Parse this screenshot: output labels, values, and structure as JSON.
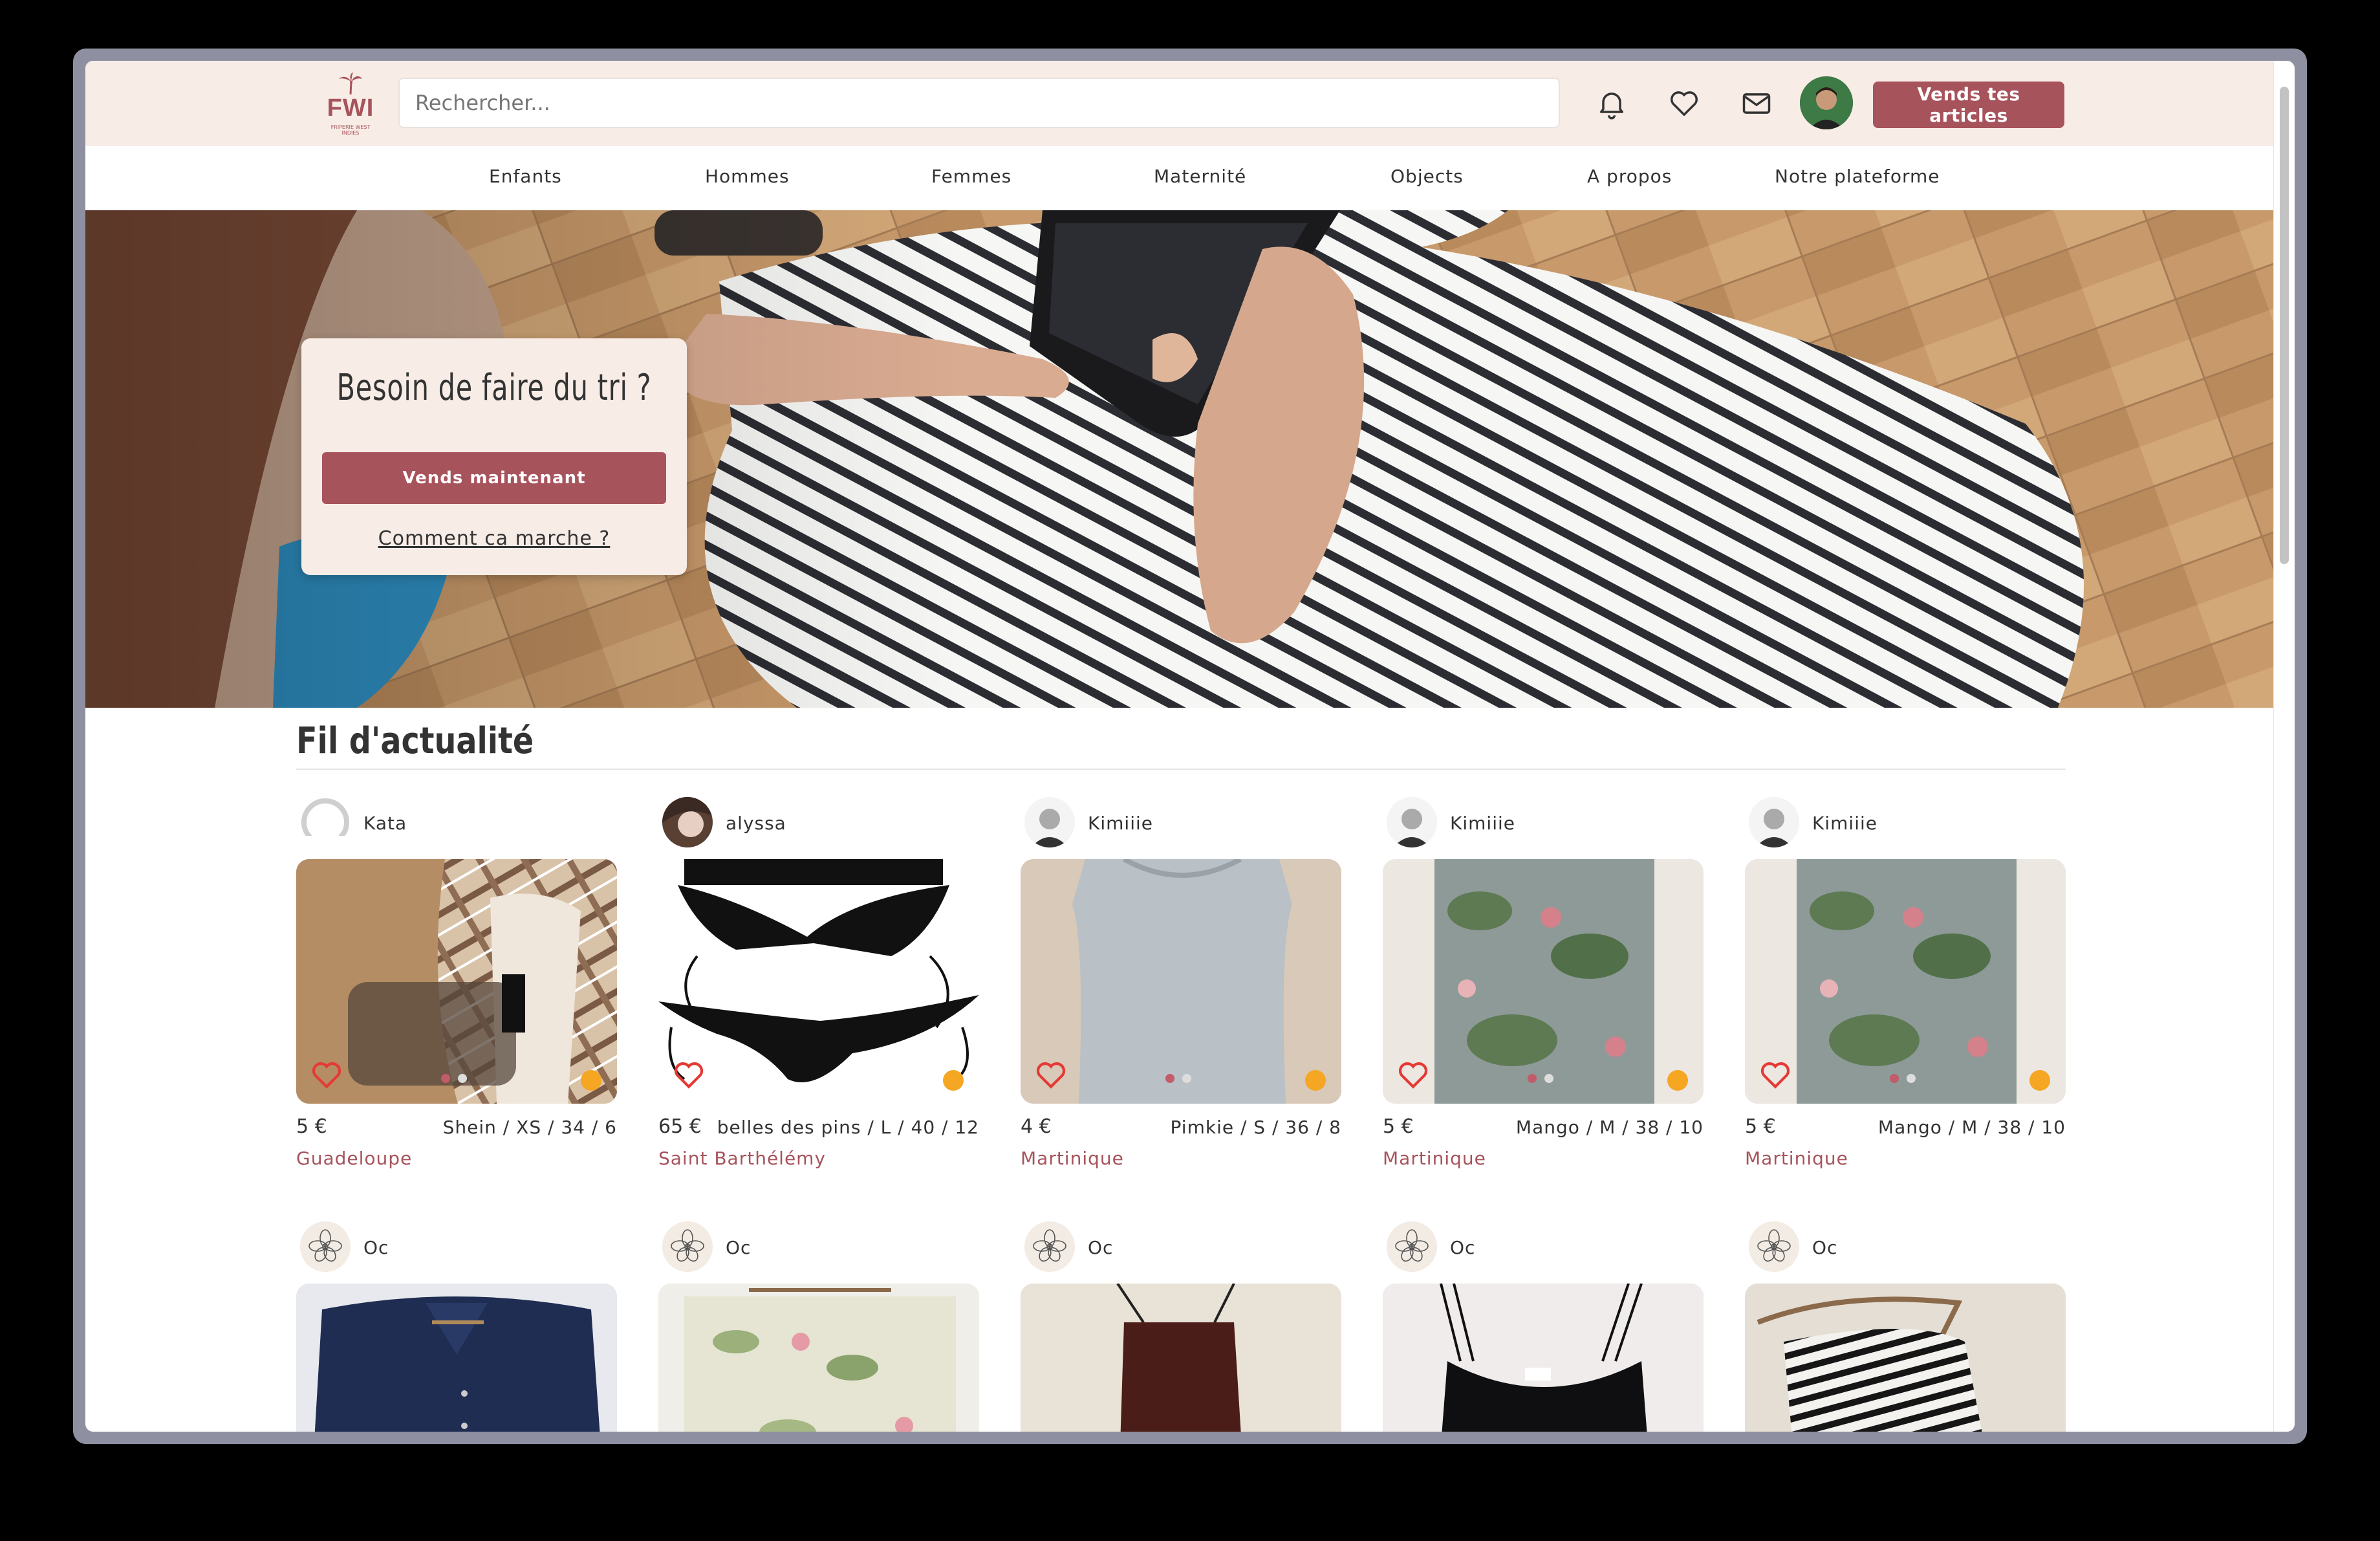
{
  "header": {
    "logo_text": "FWI",
    "logo_subtext": "FRIPERIE WEST INDIES",
    "search_placeholder": "Rechercher...",
    "sell_button": "Vends tes articles",
    "icons": [
      "bell-icon",
      "heart-icon",
      "mail-icon"
    ]
  },
  "nav": {
    "items": [
      {
        "label": "Enfants"
      },
      {
        "label": "Hommes"
      },
      {
        "label": "Femmes"
      },
      {
        "label": "Maternité"
      },
      {
        "label": "Objects"
      },
      {
        "label": "A propos"
      },
      {
        "label": "Notre plateforme"
      }
    ]
  },
  "hero": {
    "title": "Besoin de faire du tri ?",
    "button": "Vends maintenant",
    "link": "Comment ca marche ?"
  },
  "feed": {
    "title": "Fil d'actualité",
    "row1": [
      {
        "user": "Kata",
        "price": "5 €",
        "meta": "Shein / XS / 34 / 6",
        "location": "Guadeloupe"
      },
      {
        "user": "alyssa",
        "price": "65 €",
        "meta": "belles des pins / L / 40 / 12",
        "location": "Saint Barthélémy"
      },
      {
        "user": "Kimiiie",
        "price": "4 €",
        "meta": "Pimkie / S / 36 / 8",
        "location": "Martinique"
      },
      {
        "user": "Kimiiie",
        "price": "5 €",
        "meta": "Mango / M / 38 / 10",
        "location": "Martinique"
      },
      {
        "user": "Kimiiie",
        "price": "5 €",
        "meta": "Mango / M / 38 / 10",
        "location": "Martinique"
      }
    ],
    "row2": [
      {
        "user": "Oc"
      },
      {
        "user": "Oc"
      },
      {
        "user": "Oc"
      },
      {
        "user": "Oc"
      },
      {
        "user": "Oc"
      }
    ]
  },
  "colors": {
    "brand": "#a7535c",
    "header_bg": "#f8ece6",
    "status_dot": "#f5a623",
    "favorite_icon": "#e53935"
  }
}
